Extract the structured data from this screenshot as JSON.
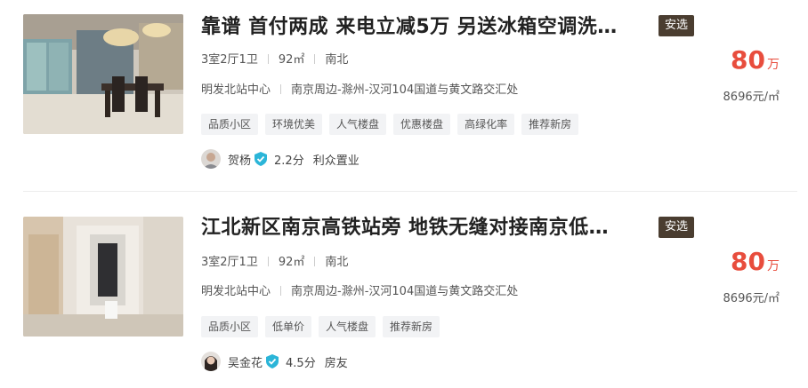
{
  "listings": [
    {
      "title": "靠谱 首付两成 来电立减5万 另送冰箱空调洗…",
      "badge": "安选",
      "layout": "3室2厅1卫",
      "area": "92㎡",
      "orientation": "南北",
      "district": "明发北站中心",
      "address": "南京周边-滁州-汉河104国道与黄文路交汇处",
      "features": [
        "品质小区",
        "环境优美",
        "人气楼盘",
        "优惠楼盘",
        "高绿化率",
        "推荐新房"
      ],
      "agent_name": "贺杨",
      "agent_score": "2.2分",
      "agent_company": "利众置业",
      "price_number": "80",
      "price_unit": "万",
      "unit_price": "8696元/㎡"
    },
    {
      "title": "江北新区南京高铁站旁 地铁无缝对接南京低…",
      "badge": "安选",
      "layout": "3室2厅1卫",
      "area": "92㎡",
      "orientation": "南北",
      "district": "明发北站中心",
      "address": "南京周边-滁州-汉河104国道与黄文路交汇处",
      "features": [
        "品质小区",
        "低单价",
        "人气楼盘",
        "推荐新房"
      ],
      "agent_name": "吴金花",
      "agent_score": "4.5分",
      "agent_company": "房友",
      "price_number": "80",
      "price_unit": "万",
      "unit_price": "8696元/㎡"
    }
  ],
  "colors": {
    "price": "#e84d3d",
    "badge_bg": "#4a3d30",
    "tag_bg": "#f2f3f5",
    "verified": "#2bb5d8"
  },
  "icons": {
    "verified": "shield-check-icon"
  }
}
